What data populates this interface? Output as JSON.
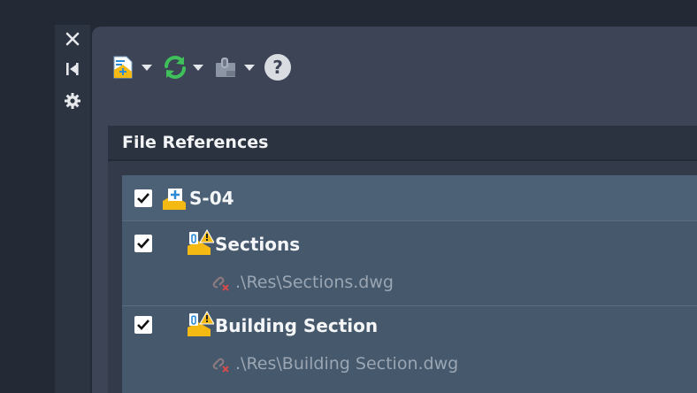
{
  "side_bar": {
    "close_icon": "close-icon",
    "auto_hide_icon": "auto-hide-icon",
    "settings_icon": "gear-icon"
  },
  "toolbar": {
    "buttons": [
      {
        "icon": "attach-dwg-icon",
        "has_dropdown": true
      },
      {
        "icon": "refresh-icon",
        "has_dropdown": true,
        "color": "#3fc05a"
      },
      {
        "icon": "change-path-icon",
        "has_dropdown": true
      },
      {
        "icon": "help-icon",
        "label": "?"
      }
    ]
  },
  "file_references": {
    "title": "File References",
    "items": [
      {
        "name": "S-04",
        "checked": true,
        "type": "drawing",
        "level": 0
      },
      {
        "name": "Sections",
        "checked": true,
        "type": "xref-warning",
        "level": 1,
        "path": ".\\Res\\Sections.dwg"
      },
      {
        "name": "Building Section",
        "checked": true,
        "type": "xref-warning",
        "level": 1,
        "path": ".\\Res\\Building Section.dwg"
      }
    ]
  },
  "colors": {
    "accent_warning": "#f5b914",
    "accent_blue": "#2d8ad6",
    "broken_link": "#d94a4a"
  }
}
